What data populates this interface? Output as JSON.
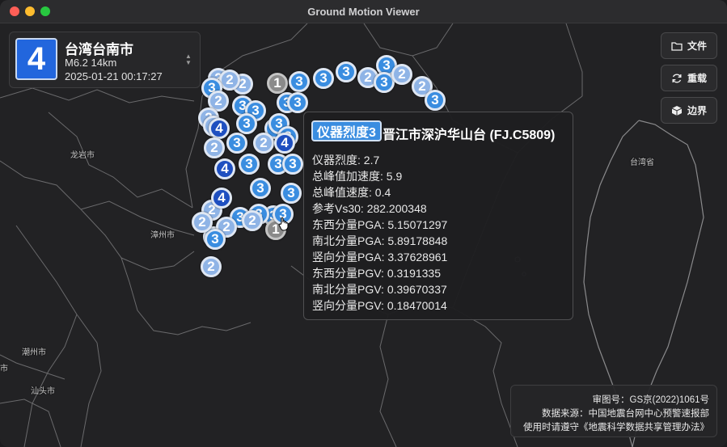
{
  "window": {
    "title": "Ground Motion Viewer"
  },
  "quake_card": {
    "intensity": "4",
    "location": "台湾台南市",
    "magnitude_depth": "M6.2 14km",
    "time": "2025-01-21 00:17:27"
  },
  "buttons": {
    "file": "文件",
    "reload": "重载",
    "boundary": "边界"
  },
  "map_labels": {
    "longyan": "龙岩市",
    "zhangzhou": "漳州市",
    "chaozhou": "潮州市",
    "shantou": "汕头市",
    "taiwan": "台湾省",
    "edge": "市"
  },
  "tooltip": {
    "badge": "仪器烈度3",
    "station": "晋江市深沪华山台 (FJ.C5809)",
    "rows": [
      "仪器烈度: 2.7",
      "总峰值加速度: 5.9",
      "总峰值速度: 0.4",
      "参考Vs30: 282.200348",
      "东西分量PGA: 5.15071297",
      "南北分量PGA: 5.89178848",
      "竖向分量PGA: 3.37628961",
      "东西分量PGV: 0.3191335",
      "南北分量PGV: 0.39670337",
      "竖向分量PGV: 0.18470014"
    ]
  },
  "attribution": {
    "review": "审图号：GS京(2022)1061号",
    "source": "数据来源：中国地震台网中心预警速报部",
    "usage": "使用时请遵守《地震科学数据共享管理办法》"
  },
  "intensity_colors": {
    "1": "#8a8a8a",
    "2": "#8fb4e6",
    "3": "#3a8de0",
    "4": "#1e4fc0"
  },
  "stations": [
    {
      "v": "2",
      "c": 2
    },
    {
      "v": "2",
      "c": 2
    },
    {
      "v": "2",
      "c": 2
    },
    {
      "v": "3",
      "c": 3
    },
    {
      "v": "2",
      "c": 2
    },
    {
      "v": "1",
      "c": 1
    },
    {
      "v": "3",
      "c": 3
    },
    {
      "v": "3",
      "c": 3
    },
    {
      "v": "3",
      "c": 3
    },
    {
      "v": "2",
      "c": 2
    },
    {
      "v": "3",
      "c": 3
    },
    {
      "v": "3",
      "c": 3
    },
    {
      "v": "2",
      "c": 2
    },
    {
      "v": "2",
      "c": 2
    },
    {
      "v": "3",
      "c": 3
    },
    {
      "v": "2",
      "c": 2
    },
    {
      "v": "3",
      "c": 3
    },
    {
      "v": "3",
      "c": 3
    },
    {
      "v": "3",
      "c": 3
    },
    {
      "v": "3",
      "c": 3
    },
    {
      "v": "2",
      "c": 2
    },
    {
      "v": "4",
      "c": 4
    },
    {
      "v": "3",
      "c": 3
    },
    {
      "v": "3",
      "c": 3
    },
    {
      "v": "3",
      "c": 3
    },
    {
      "v": "3",
      "c": 3
    },
    {
      "v": "2",
      "c": 2
    },
    {
      "v": "3",
      "c": 3
    },
    {
      "v": "4",
      "c": 4
    },
    {
      "v": "2",
      "c": 2
    },
    {
      "v": "3",
      "c": 3
    },
    {
      "v": "3",
      "c": 3
    },
    {
      "v": "4",
      "c": 4
    },
    {
      "v": "3",
      "c": 3
    },
    {
      "v": "3",
      "c": 3
    },
    {
      "v": "3",
      "c": 3
    },
    {
      "v": "2",
      "c": 2
    },
    {
      "v": "4",
      "c": 4
    },
    {
      "v": "3",
      "c": 3
    },
    {
      "v": "3",
      "c": 3
    },
    {
      "v": "3",
      "c": 3
    },
    {
      "v": "2",
      "c": 2
    },
    {
      "v": "3",
      "c": 3
    },
    {
      "v": "1",
      "c": 1
    },
    {
      "v": "3",
      "c": 3
    },
    {
      "v": "3",
      "c": 3
    },
    {
      "v": "2",
      "c": 2
    },
    {
      "v": "2",
      "c": 2
    },
    {
      "v": "2",
      "c": 2
    }
  ]
}
